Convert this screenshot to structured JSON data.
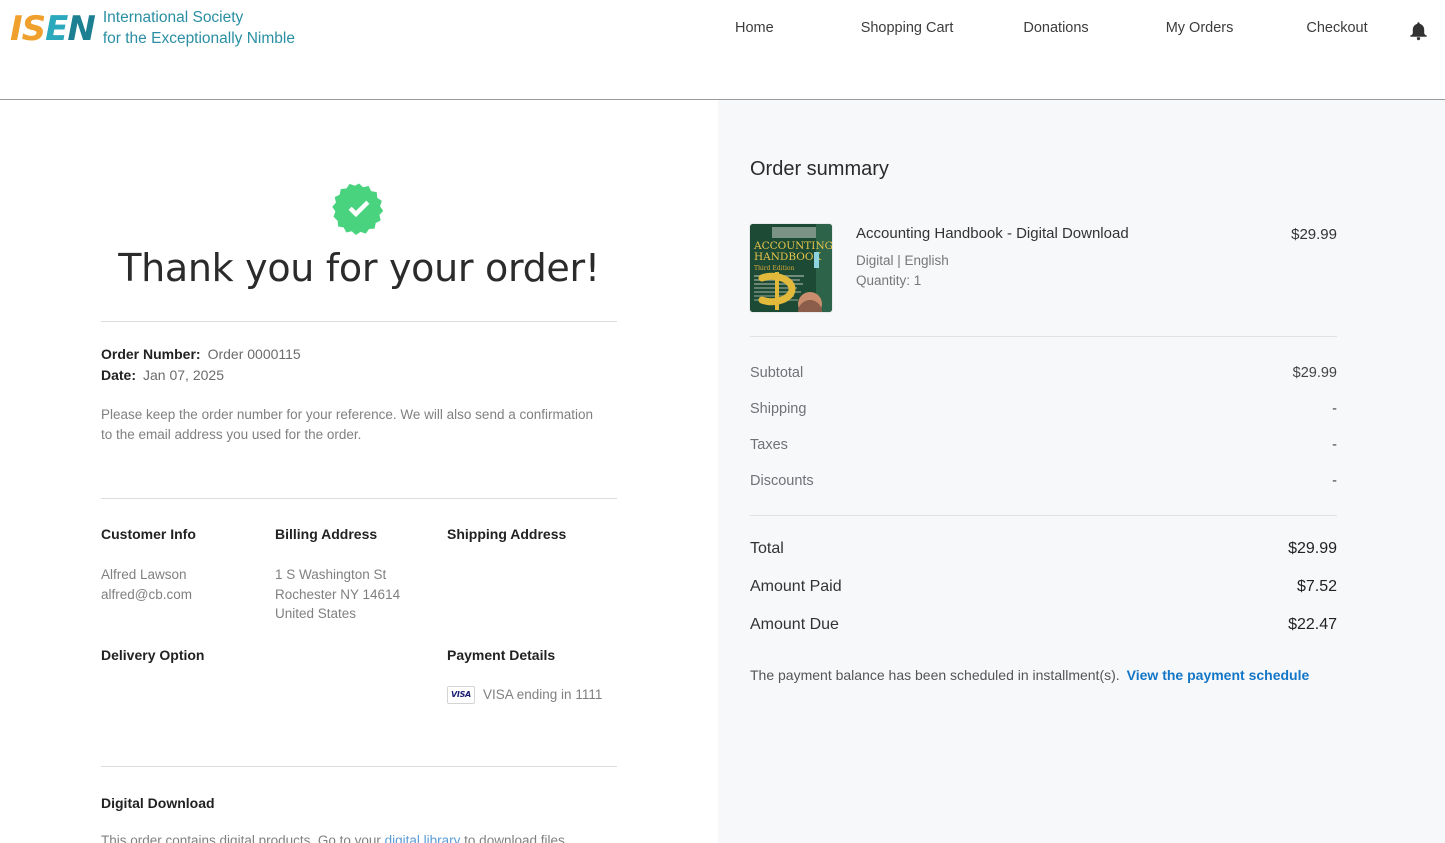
{
  "header": {
    "logo": {
      "mark_parts": [
        "I",
        "S",
        "E",
        "N"
      ],
      "line1": "International Society",
      "line2": "for the Exceptionally Nimble",
      "colors": {
        "orange": "#f0a02c",
        "teal": "#2aa8bc",
        "dark_teal": "#1d7f92",
        "text": "#2a8fa3"
      }
    },
    "nav": [
      {
        "label": "Home"
      },
      {
        "label": "Shopping Cart"
      },
      {
        "label": "Donations"
      },
      {
        "label": "My Orders"
      },
      {
        "label": "Checkout"
      }
    ],
    "notifications_icon": "bell-icon"
  },
  "confirmation": {
    "status_icon": "check-badge-icon",
    "status_color": "#4ad37f",
    "heading": "Thank you for your order!",
    "order_number_label": "Order Number:",
    "order_number_value": "Order 0000115",
    "date_label": "Date:",
    "date_value": "Jan 07, 2025",
    "note": "Please keep the order number for your reference. We will also send a confirmation to the email address you used for the order."
  },
  "customer_info": {
    "title": "Customer Info",
    "lines": [
      "Alfred Lawson",
      "alfred@cb.com"
    ]
  },
  "billing_address": {
    "title": "Billing Address",
    "lines": [
      "1 S Washington St",
      "Rochester NY 14614",
      "United States"
    ]
  },
  "shipping_address": {
    "title": "Shipping Address",
    "lines": []
  },
  "delivery_option": {
    "title": "Delivery Option",
    "value": ""
  },
  "payment_details": {
    "title": "Payment Details",
    "card_brand": "VISA",
    "card_text": "VISA ending in 1111"
  },
  "digital_download": {
    "title": "Digital Download",
    "text_before": "This order contains digital products. Go to your ",
    "link_text": "digital library",
    "text_after": " to download files.",
    "link_color": "#5b9bd5"
  },
  "order_summary": {
    "title": "Order summary",
    "item": {
      "image_alt": "Accounting Handbook book cover",
      "cover_title_line1": "ACCOUNTING",
      "cover_title_line2": "HANDBOOK",
      "cover_subtitle": "Third Edition",
      "name": "Accounting Handbook - Digital Download",
      "attributes": "Digital | English",
      "quantity": "Quantity: 1",
      "price": "$29.99"
    },
    "lines": [
      {
        "label": "Subtotal",
        "value": "$29.99"
      },
      {
        "label": "Shipping",
        "value": "-"
      },
      {
        "label": "Taxes",
        "value": "-"
      },
      {
        "label": "Discounts",
        "value": "-"
      }
    ],
    "totals": [
      {
        "label": "Total",
        "value": "$29.99"
      },
      {
        "label": "Amount Paid",
        "value": "$7.52"
      },
      {
        "label": "Amount Due",
        "value": "$22.47"
      }
    ],
    "schedule_note": "The payment balance has been scheduled in installment(s).",
    "schedule_link": "View the payment schedule",
    "schedule_link_color": "#1476c6"
  }
}
